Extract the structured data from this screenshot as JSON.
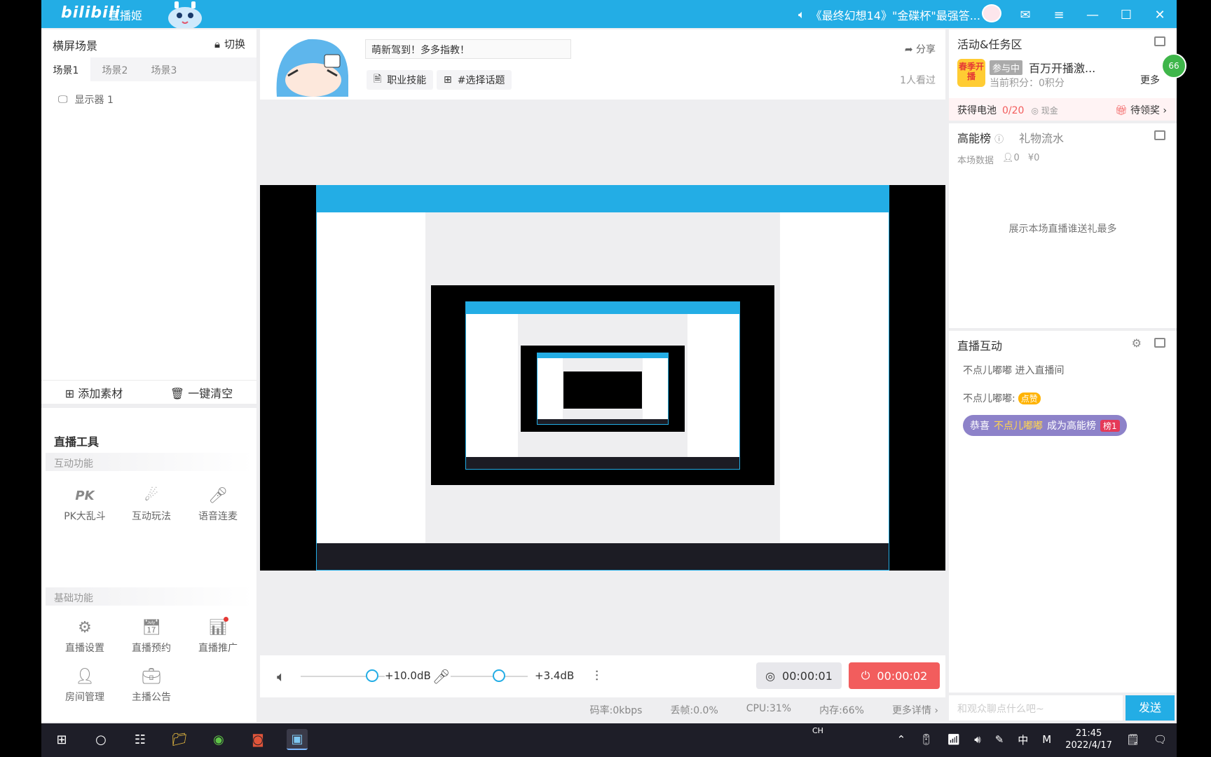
{
  "titlebar": {
    "logo": "bilibili",
    "app_name": "直播姬",
    "notice": "《最终幻想14》\"金碟杯\"最强答..."
  },
  "left": {
    "scene_title": "横屏场景",
    "switch_label": "切换",
    "tabs": [
      "场景1",
      "场景2",
      "场景3"
    ],
    "display_item": "显示器 1",
    "add_material": "添加素材",
    "clear_all": "一键清空",
    "tools_title": "直播工具",
    "interactive_section": "互动功能",
    "interactive_tools": [
      "PK大乱斗",
      "互动玩法",
      "语音连麦"
    ],
    "basic_section": "基础功能",
    "basic_tools": [
      "直播设置",
      "直播预约",
      "直播推广",
      "房间管理",
      "主播公告"
    ]
  },
  "center": {
    "title_value": "萌新驾到！多多指教！",
    "tag_skill": "职业技能",
    "tag_topic": "#选择话题",
    "share": "分享",
    "viewers": "1人看过",
    "desktop_volume": "+10.0dB",
    "mic_volume": "+3.4dB",
    "record_time": "00:00:01",
    "live_time": "00:00:02",
    "desktop_volume_level": 0.85,
    "mic_volume_level": 0.63,
    "status": {
      "bitrate": "码率:0kbps",
      "drop": "丢帧:0.0%",
      "cpu": "CPU:31%",
      "mem": "内存:66%",
      "more": "更多详情"
    }
  },
  "right": {
    "activity_title": "活动&任务区",
    "badge_text": "春季开播",
    "joined": "参与中",
    "activity_name": "百万开播激...",
    "points": "当前积分：0积分",
    "more": "更多",
    "green_badge": "66",
    "battery_label": "获得电池",
    "battery_count": "0/20",
    "cash_label": "现金",
    "claim_label": "待领奖",
    "rank_title": "高能榜",
    "gift_flow": "礼物流水",
    "session_data": "本场数据",
    "people_count": "0",
    "money": "¥0",
    "rank_empty": "展示本场直播谁送礼最多",
    "interact_title": "直播互动",
    "msg_enter": "不点儿嘟嘟 进入直播间",
    "msg_like_user": "不点儿嘟嘟:",
    "msg_like_tag": "点赞",
    "rank_msg_pre": "恭喜",
    "rank_msg_user": "不点儿嘟嘟",
    "rank_msg_post": "成为高能榜",
    "rank_msg_badge": "榜1",
    "chat_placeholder": "和观众聊点什么吧~",
    "send": "发送"
  },
  "taskbar": {
    "input_ch": "CH",
    "ime_zh": "中",
    "ime_m": "M",
    "time": "21:45",
    "date": "2022/4/17"
  }
}
